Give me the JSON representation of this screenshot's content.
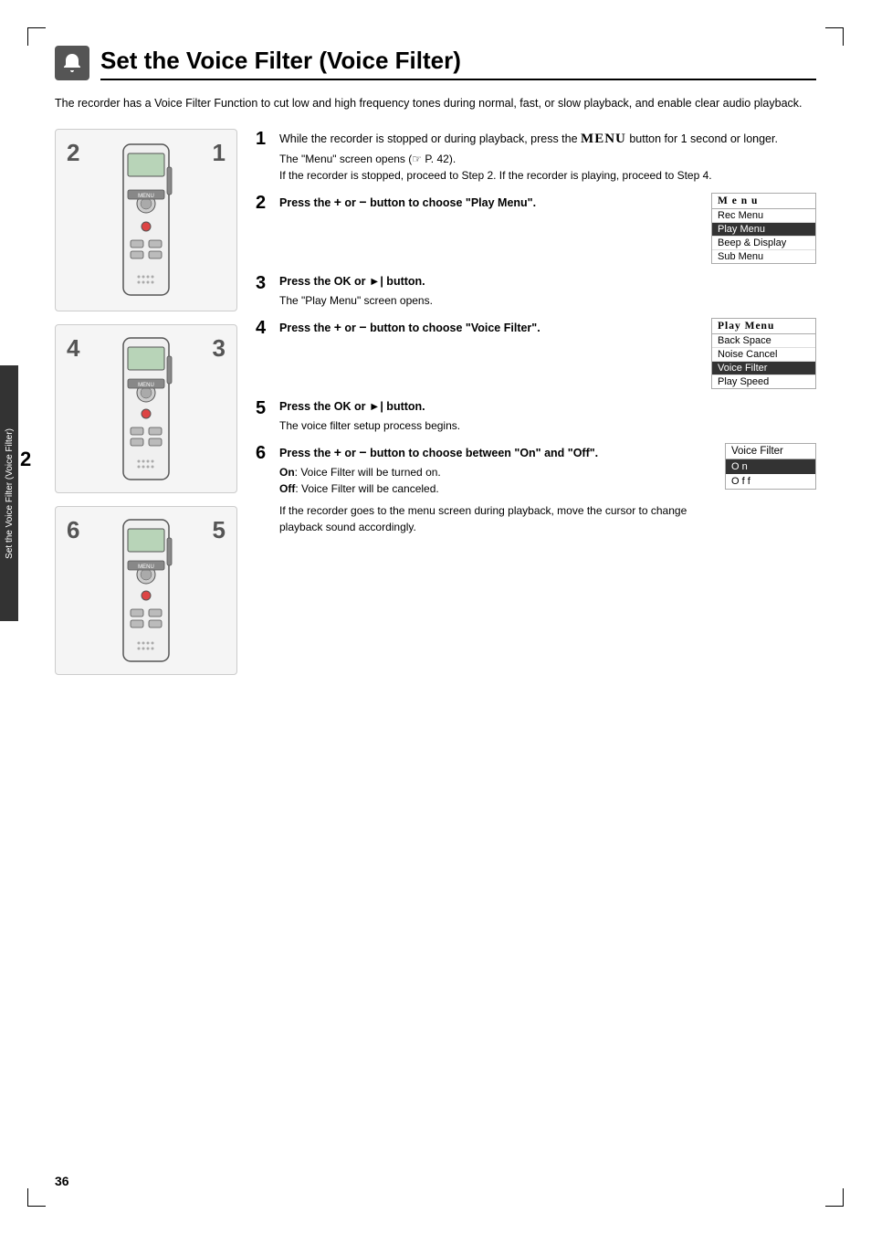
{
  "page": {
    "number": "36",
    "title": "Set the Voice Filter (Voice Filter)",
    "sidebar_label": "Set the Voice Filter (Voice Filter)",
    "sidebar_number": "2"
  },
  "intro": {
    "text": "The recorder has a Voice Filter Function to cut low and high frequency tones during normal, fast, or slow playback, and enable clear audio playback."
  },
  "steps": [
    {
      "num": "1",
      "instruction": "While the recorder is stopped or during playback, press the MENU button for 1 second or longer.",
      "sub": "The \"Menu\" screen opens (☞ P. 42). If the recorder is stopped, proceed to Step 2. If the recorder is playing, proceed to Step 4.",
      "has_menu": false
    },
    {
      "num": "2",
      "instruction": "Press the + or − button to choose \"Play Menu\".",
      "sub": "",
      "has_menu": true,
      "menu_type": "main"
    },
    {
      "num": "3",
      "instruction": "Press the OK or ►| button.",
      "sub": "The \"Play Menu\" screen opens.",
      "has_menu": false
    },
    {
      "num": "4",
      "instruction": "Press the + or − button to choose \"Voice Filter\".",
      "sub": "",
      "has_menu": true,
      "menu_type": "play"
    },
    {
      "num": "5",
      "instruction": "Press the OK or ►| button.",
      "sub": "The voice filter setup process begins.",
      "has_menu": false
    },
    {
      "num": "6",
      "instruction": "Press the + or − button to choose between \"On\" and \"Off\".",
      "sub": "On: Voice Filter will be turned on.\nOff: Voice Filter will be canceled.\n\nIf the recorder goes to the menu screen during playback, move the cursor to change playback sound accordingly.",
      "has_menu": true,
      "menu_type": "voice_filter"
    }
  ],
  "menu_main": {
    "title": "M e n u",
    "items": [
      {
        "label": "Rec Menu",
        "highlighted": false
      },
      {
        "label": "Play Menu",
        "highlighted": true
      },
      {
        "label": "Beep & Display",
        "highlighted": false
      },
      {
        "label": "Sub Menu",
        "highlighted": false
      }
    ]
  },
  "menu_play": {
    "title": "Play Menu",
    "items": [
      {
        "label": "Back Space",
        "highlighted": false
      },
      {
        "label": "Noise Cancel",
        "highlighted": false
      },
      {
        "label": "Voice Filter",
        "highlighted": true
      },
      {
        "label": "Play Speed",
        "highlighted": false
      }
    ]
  },
  "menu_voice_filter": {
    "title": "Voice Filter",
    "items": [
      {
        "label": "O n",
        "highlighted": true
      },
      {
        "label": "O f f",
        "highlighted": false
      }
    ]
  },
  "device_labels": {
    "top": [
      "2",
      "1"
    ],
    "middle": [
      "4",
      "3"
    ],
    "bottom": [
      "6",
      "5"
    ]
  }
}
